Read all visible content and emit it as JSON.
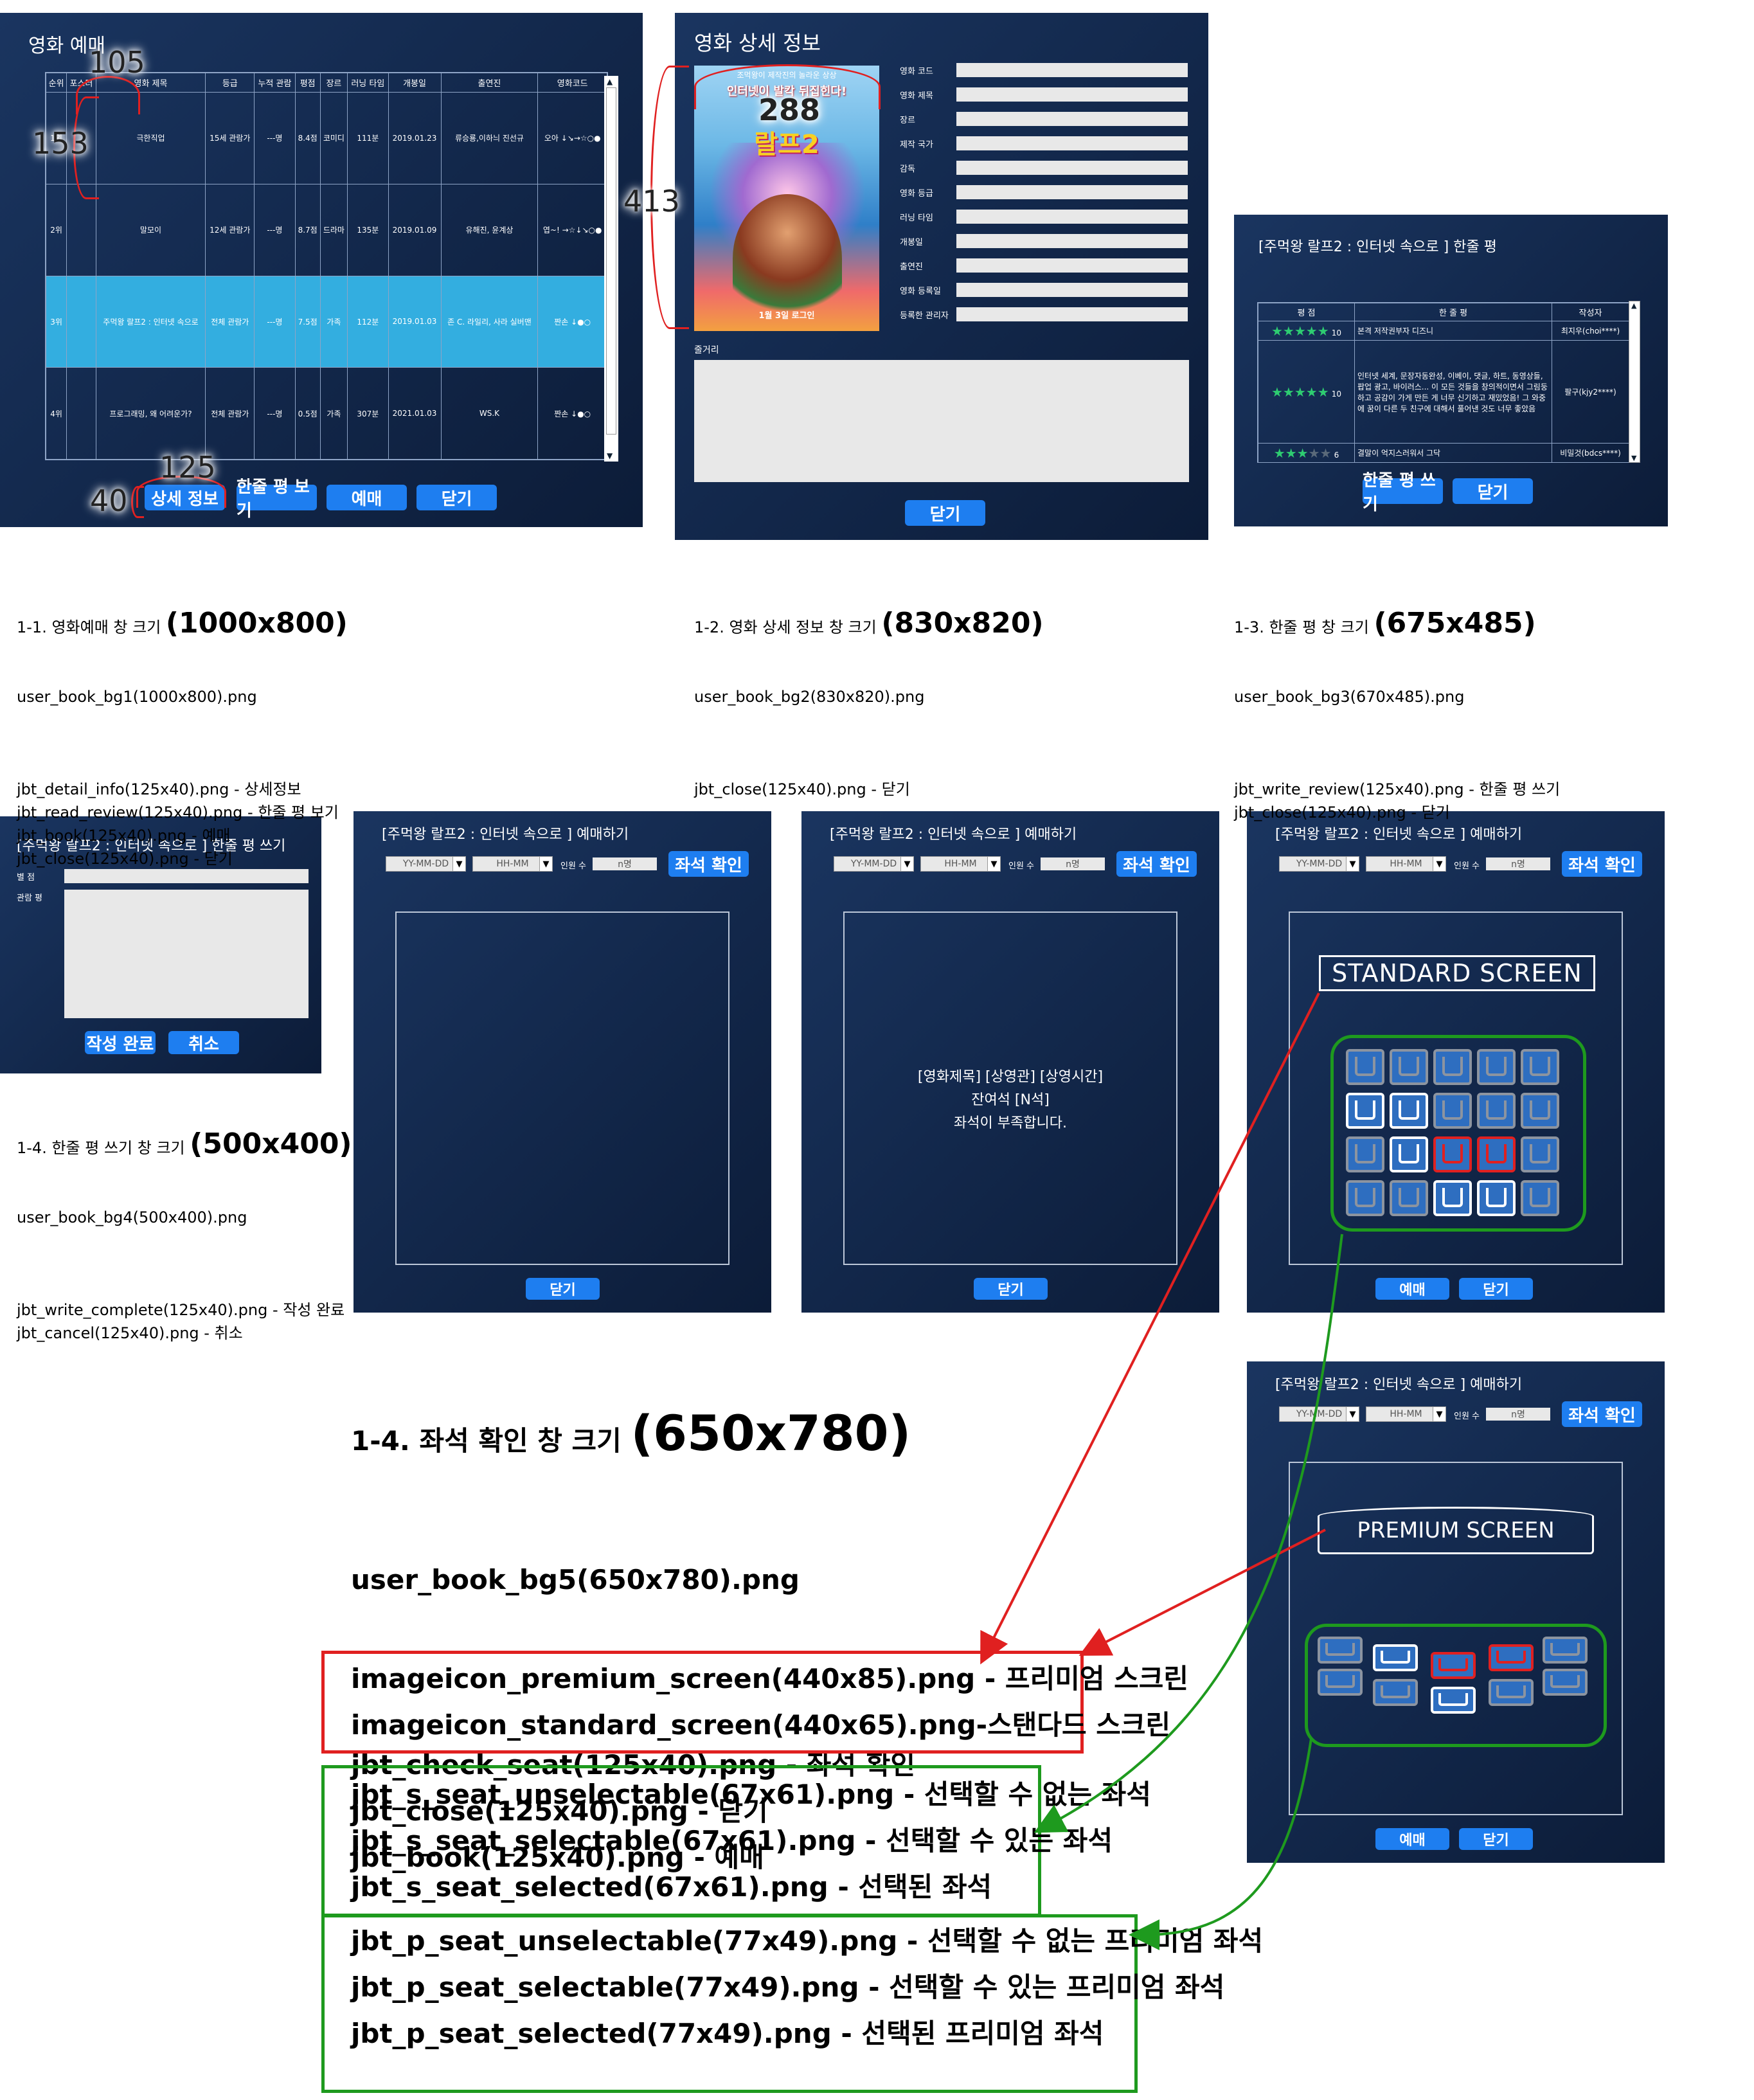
{
  "w1": {
    "title": "영화 예매",
    "headers": [
      "순위",
      "포스터",
      "영화 제목",
      "등급",
      "누적 관람",
      "평점",
      "장르",
      "러닝 타임",
      "개봉일",
      "출연진",
      "영화코드"
    ],
    "rows": [
      {
        "rank": "1위",
        "title": "극한직업",
        "grade": "15세 관람가",
        "aud": "---명",
        "rate": "8.4점",
        "genre": "코미디",
        "run": "111분",
        "open": "2019.01.23",
        "cast": "류승룡,이하늬 진선규",
        "code": "오아 ↓↘→☆○●"
      },
      {
        "rank": "2위",
        "title": "말모이",
        "grade": "12세 관람가",
        "aud": "---명",
        "rate": "8.7점",
        "genre": "드라마",
        "run": "135분",
        "open": "2019.01.09",
        "cast": "유해진, 윤계상",
        "code": "엽~! →☆↓↘○●"
      },
      {
        "rank": "3위",
        "title": "주먹왕 랄프2 : 인터넷 속으로",
        "grade": "전체 관람가",
        "aud": "---명",
        "rate": "7.5점",
        "genre": "가족",
        "run": "112분",
        "open": "2019.01.03",
        "cast": "존 C. 라일리, 사라 실버맨",
        "code": "짠손 ↓●○"
      },
      {
        "rank": "4위",
        "title": "프로그래밍, 왜 어려운가?",
        "grade": "전체 관람가",
        "aud": "---명",
        "rate": "0.5점",
        "genre": "가족",
        "run": "307분",
        "open": "2021.01.03",
        "cast": "WS.K",
        "code": "짠손 ↓●○"
      }
    ],
    "buttons": [
      "상세 정보",
      "한줄 평 보기",
      "예매",
      "닫기"
    ],
    "anno": {
      "a105": "105",
      "a153": "153",
      "a125": "125",
      "a40": "40"
    }
  },
  "w2": {
    "title": "영화 상세 정보",
    "labels": [
      "영화 코드",
      "영화 제목",
      "장르",
      "제작 국가",
      "감독",
      "영화 등급",
      "러닝 타임",
      "개봉일",
      "출연진",
      "영화 등록일",
      "등록한 관리자"
    ],
    "plot_label": "줄거리",
    "close": "닫기",
    "anno": "413",
    "anno2": "288",
    "poster": {
      "top": "조먹왕이 제작진의 놀라운 상상",
      "head": "인터넷이 발칵 뒤집힌다!",
      "title": "랄프2",
      "date": "1월 3일 로그인"
    }
  },
  "w3": {
    "title": "[주먹왕 랄프2 : 인터넷 속으로 ] 한줄 평",
    "headers": [
      "평 점",
      "한 줄 평",
      "작성자"
    ],
    "rows": [
      {
        "stars": 5,
        "score": "10",
        "text": "본격 저작권부자 디즈니",
        "writer": "최지우(choi****)"
      },
      {
        "stars": 5,
        "score": "10",
        "text": "인터넷 세계, 문장자동완성, 이베이, 댓글, 하트, 동영상들, 팝업 광고, 바이러스... 이 모든 것들을 창의적이면서 그림둥하고 공감이 가게 만든 게 너무 신기하고 재밌었음! 그 와중에 꿈이 다른 두 친구에 대해서 풀어낸 것도 너무 좋았음",
        "writer": "팔구(kjy2****)"
      },
      {
        "stars": 3,
        "score": "6",
        "text": "결말이 억지스러워서 그닥",
        "writer": "비밀것(bdcs****)"
      }
    ],
    "buttons": [
      "한줄 평 쓰기",
      "닫기"
    ]
  },
  "w4": {
    "title": "[주먹왕 랄프2 : 인터넷 속으로 ] 한줄 평 쓰기",
    "l1": "별 점",
    "l2": "관람 평",
    "buttons": [
      "작성 완료",
      "취소"
    ]
  },
  "book": {
    "title": "[주먹왕 랄프2 : 인터넷 속으로 ] 예매하기",
    "date": "YY-MM-DD",
    "time": "HH-MM",
    "count_label": "인원 수",
    "count": "n명",
    "check": "좌석 확인",
    "close": "닫기",
    "book": "예매",
    "msg": [
      "[영화제목] [상영관] [상영시간]",
      "잔여석 [N석]",
      "좌석이 부족합니다."
    ],
    "standard": "STANDARD SCREEN",
    "premium": "PREMIUM SCREEN"
  },
  "captions": {
    "c1": {
      "a": "1-1. 영화예매 창 크기 ",
      "b": "(1000x800)",
      "c": "user_book_bg1(1000x800).png",
      "d": "jbt_detail_info(125x40).png - 상세정보\njbt_read_review(125x40).png - 한줄 평 보기\njbt_book(125x40).png - 예매\njbt_close(125x40).png - 닫기"
    },
    "c2": {
      "a": "1-2. 영화 상세 정보 창 크기 ",
      "b": "(830x820)",
      "c": "user_book_bg2(830x820).png",
      "d": "jbt_close(125x40).png - 닫기"
    },
    "c3": {
      "a": "1-3. 한줄 평 창 크기 ",
      "b": "(675x485)",
      "c": "user_book_bg3(670x485).png",
      "d": "jbt_write_review(125x40).png - 한줄 평 쓰기\njbt_close(125x40).png - 닫기"
    },
    "c4": {
      "a": "1-4. 한줄 평 쓰기 창 크기 ",
      "b": "(500x400)",
      "c": "user_book_bg4(500x400).png",
      "d": "jbt_write_complete(125x40).png - 작성 완료\njbt_cancel(125x40).png - 취소"
    },
    "c5": {
      "a": "1-4. 좌석 확인 창 크기 ",
      "b": "(650x780)",
      "c": "user_book_bg5(650x780).png",
      "d": "jbt_check_seat(125x40).png - 좌석 확인\njbt_close(125x40).png - 닫기\njbt_book(125x40).png - 예매"
    },
    "red": "imageicon_premium_screen(440x85).png - 프리미엄 스크린\nimageicon_standard_screen(440x65).png-스탠다드 스크린",
    "g1": "jbt_s_seat_unselectable(67x61).png - 선택할 수 없는 좌석\njbt_s_seat_selectable(67x61).png - 선택할 수 있는 좌석\njbt_s_seat_selected(67x61).png - 선택된 좌석",
    "g2": "jbt_p_seat_unselectable(77x49).png - 선택할 수 없는 프리미엄 좌석\njbt_p_seat_selectable(77x49).png - 선택할 수 있는 프리미엄 좌석\njbt_p_seat_selected(77x49).png - 선택된 프리미엄 좌석"
  },
  "colors": {
    "bg": "#12274a",
    "button": "#1e7ef0",
    "highlight": "#33aee0",
    "seat_unselectable": "#8c94a0",
    "seat_selectable": "#ffffff",
    "seat_selected": "#e02020"
  }
}
